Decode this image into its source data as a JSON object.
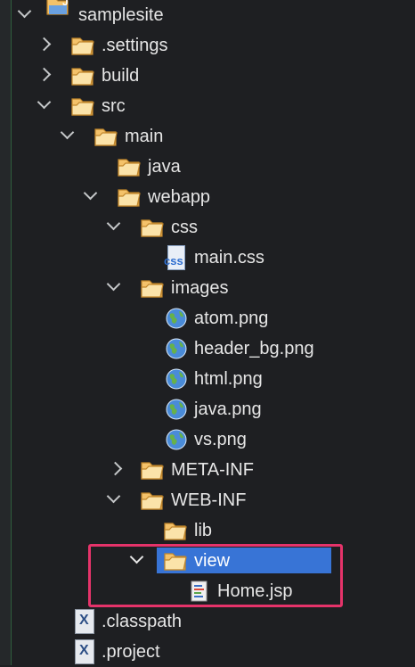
{
  "tree": {
    "project": "samplesite",
    "settings": ".settings",
    "build": "build",
    "src": "src",
    "main": "main",
    "java": "java",
    "webapp": "webapp",
    "css": "css",
    "main_css": "main.css",
    "images": "images",
    "atom": "atom.png",
    "header_bg": "header_bg.png",
    "html_png": "html.png",
    "java_png": "java.png",
    "vs_png": "vs.png",
    "meta_inf": "META-INF",
    "web_inf": "WEB-INF",
    "lib": "lib",
    "view": "view",
    "home_jsp": "Home.jsp",
    "classpath": ".classpath",
    "project_file": ".project"
  },
  "icons": {
    "css_icon_text": "css",
    "xml_icon_text": "X"
  },
  "colors": {
    "selection": "#3874d6",
    "highlight_border": "#e5336a",
    "folder": "#f1b44c"
  }
}
